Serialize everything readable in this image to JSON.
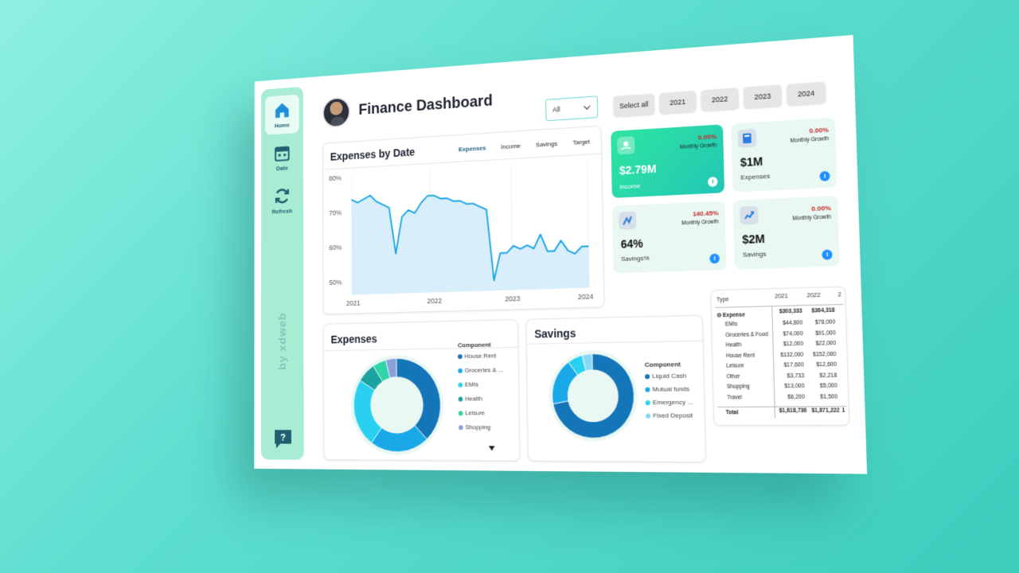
{
  "sidebar": {
    "items": [
      {
        "label": "Home",
        "icon": "home-icon",
        "active": true
      },
      {
        "label": "Date",
        "icon": "calendar-icon",
        "active": false
      },
      {
        "label": "Refresh",
        "icon": "refresh-icon",
        "active": false
      }
    ],
    "byline": "by xdweb",
    "help_icon": "help-chat-icon"
  },
  "header": {
    "title": "Finance Dashboard",
    "avatar": "user-avatar"
  },
  "filters": {
    "dropdown_value": "All",
    "years": [
      "Select all",
      "2021",
      "2022",
      "2023",
      "2024"
    ]
  },
  "line_chart": {
    "title": "Expenses by Date",
    "tabs": [
      "Expenses",
      "Income",
      "Savings",
      "Target"
    ],
    "active_tab": "Expenses",
    "y_ticks": [
      "80%",
      "70%",
      "60%",
      "50%"
    ],
    "x_ticks": [
      "2021",
      "2022",
      "2023",
      "2024"
    ]
  },
  "chart_data": [
    {
      "type": "area",
      "title": "Expenses by Date",
      "x_ticks": [
        "2021",
        "2022",
        "2023",
        "2024"
      ],
      "ylim": [
        45,
        82
      ],
      "y_unit": "%",
      "values": [
        74,
        73,
        74,
        75,
        73,
        72,
        71,
        57,
        68,
        70,
        69,
        72,
        74,
        74,
        73,
        73,
        72,
        72,
        71,
        71,
        70,
        69,
        48,
        56,
        56,
        58,
        57,
        58,
        57,
        61,
        56,
        56,
        59,
        56,
        55,
        57,
        57
      ],
      "color": "#1aa6e6",
      "fill": "#d8eefb"
    },
    {
      "type": "pie",
      "title": "Expenses",
      "legend_title": "Component",
      "labels": [
        "House Rent",
        "Groceries & ...",
        "EMIs",
        "Health",
        "Leisure",
        "Shopping"
      ],
      "values": [
        38,
        22,
        24,
        7,
        5,
        4
      ],
      "colors": [
        "#1476b8",
        "#19a8e8",
        "#2ad0f0",
        "#1aa3a0",
        "#2fd4a8",
        "#8aa0d8"
      ]
    },
    {
      "type": "pie",
      "title": "Savings",
      "legend_title": "Component",
      "labels": [
        "Liquid Cash",
        "Mutual funds",
        "Emergency ...",
        "Fixed Deposit"
      ],
      "values": [
        72,
        18,
        6,
        4
      ],
      "colors": [
        "#1476b8",
        "#19a8e8",
        "#2ad0f0",
        "#8ad6f5"
      ]
    }
  ],
  "kpis": {
    "income": {
      "value": "$2.79M",
      "name": "Income",
      "growth": "0.00%",
      "growth_label": "Monthly Growth",
      "icon": "money-hand-icon"
    },
    "expenses": {
      "value": "$1M",
      "name": "Expenses",
      "growth": "0.00%",
      "growth_label": "Monthly Growth",
      "icon": "calculator-icon"
    },
    "savings_pct": {
      "value": "64%",
      "name": "Savings%",
      "growth": "140.45%",
      "growth_label": "Monthly Growth",
      "icon": "savings-icon"
    },
    "savings": {
      "value": "$2M",
      "name": "Savings",
      "growth": "0.00%",
      "growth_label": "Monthly Growth",
      "icon": "growth-chart-icon"
    }
  },
  "table": {
    "headers": [
      "Type",
      "2021",
      "2022",
      "2"
    ],
    "group": "Expense",
    "group_values": [
      "$303,333",
      "$364,318"
    ],
    "rows": [
      {
        "label": "EMIs",
        "v2021": "$44,800",
        "v2022": "$78,000"
      },
      {
        "label": "Groceries & Food",
        "v2021": "$74,000",
        "v2022": "$91,000"
      },
      {
        "label": "Health",
        "v2021": "$12,000",
        "v2022": "$22,000"
      },
      {
        "label": "House Rent",
        "v2021": "$132,000",
        "v2022": "$152,000"
      },
      {
        "label": "Leisure",
        "v2021": "$17,600",
        "v2022": "$12,600"
      },
      {
        "label": "Other",
        "v2021": "$3,733",
        "v2022": "$2,218"
      },
      {
        "label": "Shopping",
        "v2021": "$13,000",
        "v2022": "$5,000"
      },
      {
        "label": "Travel",
        "v2021": "$6,200",
        "v2022": "$1,500"
      }
    ],
    "total_label": "Total",
    "totals": [
      "$1,618,736",
      "$1,871,222",
      "1"
    ]
  }
}
